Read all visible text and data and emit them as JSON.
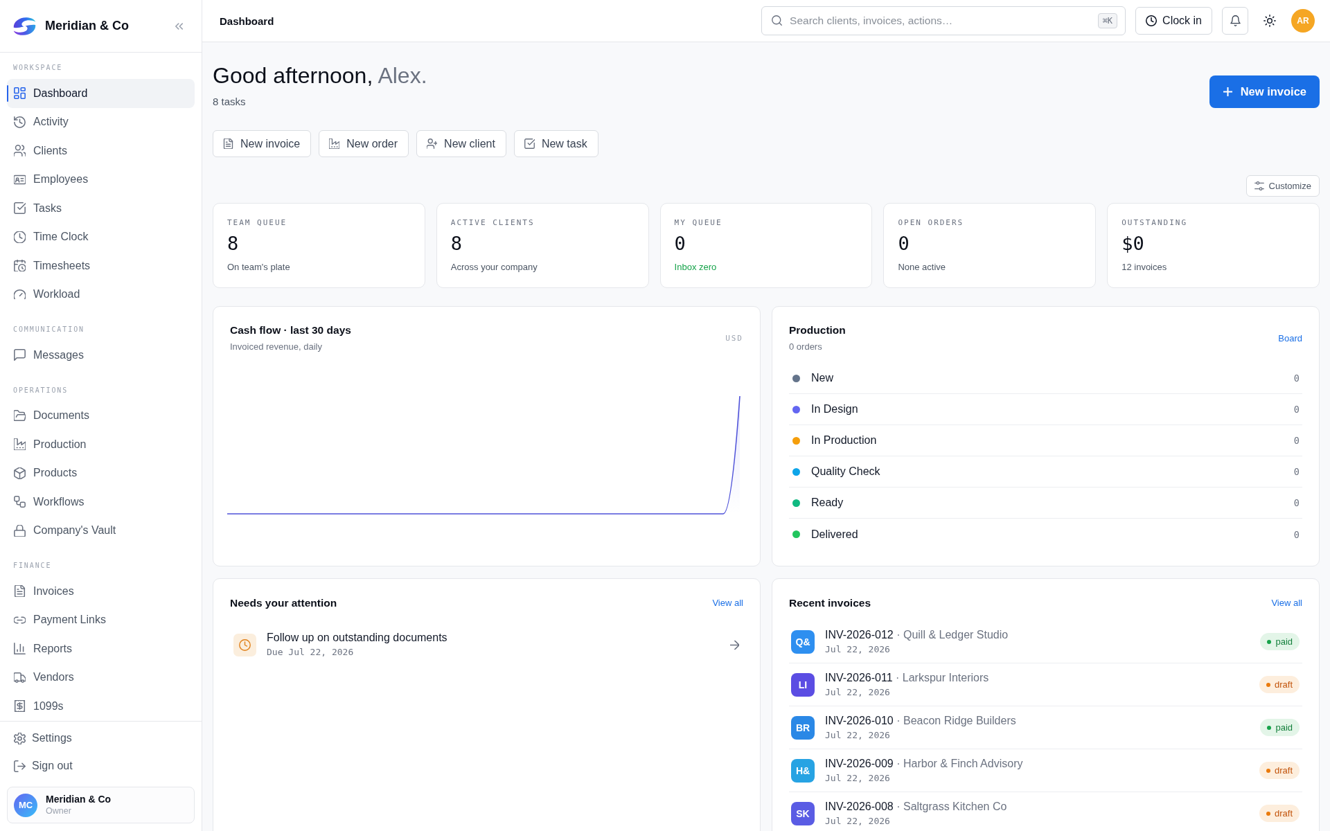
{
  "sidebar": {
    "brand": "Meridian & Co",
    "sections": [
      {
        "label": "WORKSPACE",
        "items": [
          {
            "label": "Dashboard",
            "selected": true
          },
          {
            "label": "Activity",
            "selected": false
          },
          {
            "label": "Clients",
            "selected": false
          },
          {
            "label": "Employees",
            "selected": false
          },
          {
            "label": "Tasks",
            "selected": false
          },
          {
            "label": "Time Clock",
            "selected": false
          },
          {
            "label": "Timesheets",
            "selected": false
          },
          {
            "label": "Workload",
            "selected": false
          }
        ]
      },
      {
        "label": "COMMUNICATION",
        "items": [
          {
            "label": "Messages",
            "selected": false
          }
        ]
      },
      {
        "label": "OPERATIONS",
        "items": [
          {
            "label": "Documents",
            "selected": false
          },
          {
            "label": "Production",
            "selected": false
          },
          {
            "label": "Products",
            "selected": false
          },
          {
            "label": "Workflows",
            "selected": false
          },
          {
            "label": "Company's Vault",
            "selected": false
          }
        ]
      },
      {
        "label": "FINANCE",
        "items": [
          {
            "label": "Invoices",
            "selected": false
          },
          {
            "label": "Payment Links",
            "selected": false
          },
          {
            "label": "Reports",
            "selected": false
          },
          {
            "label": "Vendors",
            "selected": false
          },
          {
            "label": "1099s",
            "selected": false
          }
        ]
      }
    ],
    "footer_items": [
      {
        "label": "Settings",
        "selected": false
      },
      {
        "label": "Sign out",
        "selected": false
      }
    ],
    "account": {
      "initials": "MC",
      "name": "Meridian & Co",
      "role": "Owner"
    }
  },
  "topbar": {
    "title": "Dashboard",
    "search": {
      "placeholder": "Search clients, invoices, actions…",
      "shortcut": "⌘K"
    },
    "clock_button": "Clock in",
    "user_initials": "AR"
  },
  "header": {
    "greeting": "Good afternoon,",
    "name": "Alex.",
    "subtitle": "8 tasks",
    "primary_button": "New invoice"
  },
  "quick_actions": [
    "New invoice",
    "New order",
    "New client",
    "New task"
  ],
  "customize_button": "Customize",
  "stats": [
    {
      "label": "TEAM QUEUE",
      "value": "8",
      "note": "On team's plate",
      "kind": "muted"
    },
    {
      "label": "ACTIVE CLIENTS",
      "value": "8",
      "note": "Across your company",
      "kind": "muted"
    },
    {
      "label": "MY QUEUE",
      "value": "0",
      "note": "Inbox zero",
      "kind": "positive"
    },
    {
      "label": "OPEN ORDERS",
      "value": "0",
      "note": "None active",
      "kind": "muted"
    },
    {
      "label": "OUTSTANDING",
      "value": "$0",
      "note": "12 invoices",
      "kind": "muted"
    }
  ],
  "cash_flow": {
    "title": "Cash flow · last 30 days",
    "subtitle": "Invoiced revenue, daily",
    "unit": "USD"
  },
  "production": {
    "title": "Production",
    "subtitle": "0 orders",
    "link": "Board",
    "stages": [
      {
        "label": "New",
        "count": "0",
        "color": "#64748b"
      },
      {
        "label": "In Design",
        "count": "0",
        "color": "#6366f1"
      },
      {
        "label": "In Production",
        "count": "0",
        "color": "#f59e0b"
      },
      {
        "label": "Quality Check",
        "count": "0",
        "color": "#0ea5e9"
      },
      {
        "label": "Ready",
        "count": "0",
        "color": "#10b981"
      },
      {
        "label": "Delivered",
        "count": "0",
        "color": "#22c55e"
      }
    ]
  },
  "attention": {
    "title": "Needs your attention",
    "link": "View all",
    "items": [
      {
        "title": "Follow up on outstanding documents",
        "due": "Due Jul 22, 2026"
      }
    ]
  },
  "recent_invoices": {
    "title": "Recent invoices",
    "link": "View all",
    "items": [
      {
        "initials": "Q&",
        "color": "#2e8ff0",
        "number": "INV-2026-012",
        "client": "· Quill & Ledger Studio",
        "date": "Jul 22, 2026",
        "status": "paid",
        "kind": "success"
      },
      {
        "initials": "LI",
        "color": "#5b4de3",
        "number": "INV-2026-011",
        "client": "· Larkspur Interiors",
        "date": "Jul 22, 2026",
        "status": "draft",
        "kind": "warning"
      },
      {
        "initials": "BR",
        "color": "#2a88e6",
        "number": "INV-2026-010",
        "client": "· Beacon Ridge Builders",
        "date": "Jul 22, 2026",
        "status": "paid",
        "kind": "success"
      },
      {
        "initials": "H&",
        "color": "#27a3e3",
        "number": "INV-2026-009",
        "client": "· Harbor & Finch Advisory",
        "date": "Jul 22, 2026",
        "status": "draft",
        "kind": "warning"
      },
      {
        "initials": "SK",
        "color": "#5a5ce4",
        "number": "INV-2026-008",
        "client": "· Saltgrass Kitchen Co",
        "date": "Jul 22, 2026",
        "status": "draft",
        "kind": "warning"
      }
    ]
  }
}
